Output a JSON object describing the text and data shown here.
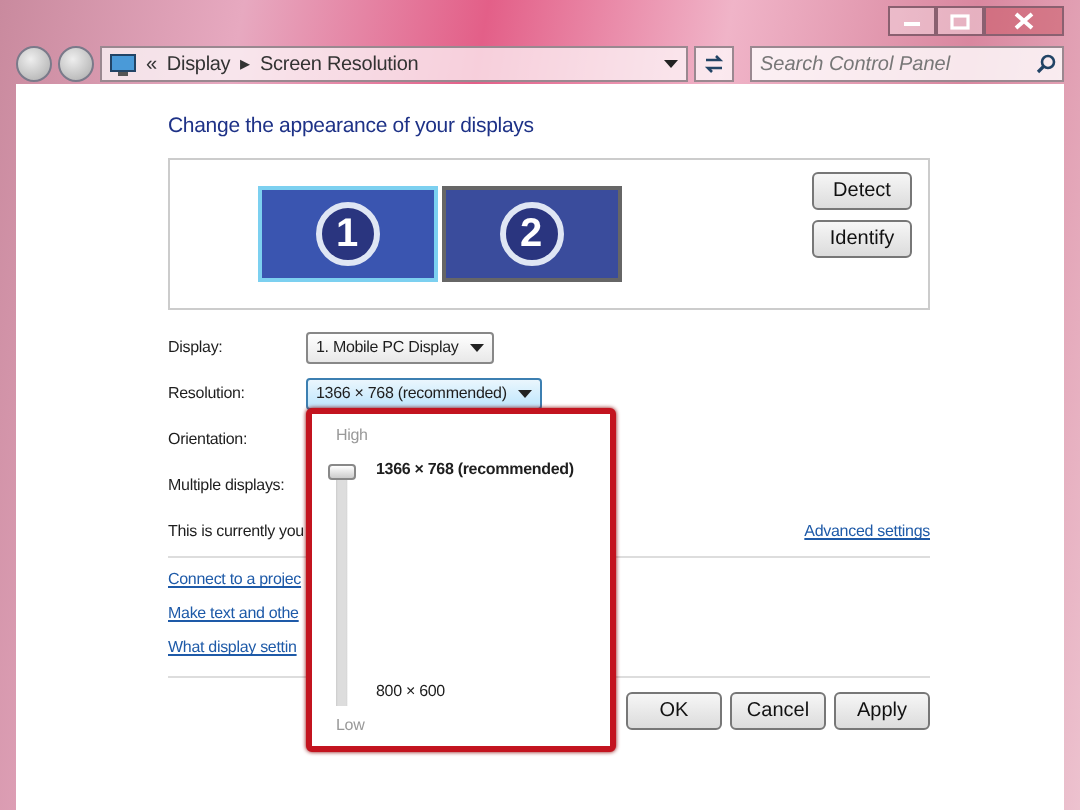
{
  "window": {
    "controls": [
      {
        "kind": "minimize"
      },
      {
        "kind": "maximize"
      },
      {
        "kind": "close"
      }
    ]
  },
  "nav": {
    "back_disabled": true,
    "forward_disabled": true
  },
  "address_bar": {
    "overflow": "«",
    "crumbs": [
      "Display",
      "Screen Resolution"
    ],
    "separator": "▸"
  },
  "search": {
    "placeholder": "Search Control Panel"
  },
  "heading": "Change the appearance of your displays",
  "monitors": [
    {
      "number": "1",
      "selected": true
    },
    {
      "number": "2",
      "selected": false
    }
  ],
  "monitor_buttons": [
    "Detect",
    "Identify"
  ],
  "settings": [
    {
      "label": "Display:",
      "value": "1. Mobile PC Display",
      "expanded": false
    },
    {
      "label": "Resolution:",
      "value": "1366 × 768 (recommended)",
      "expanded": true
    },
    {
      "label": "Orientation:"
    },
    {
      "label": "Multiple displays:"
    }
  ],
  "current_note": "This is currently you",
  "advanced_link": "Advanced settings",
  "links": [
    "Connect to a projec",
    "Make text and othe",
    "What display settin"
  ],
  "buttons": [
    "OK",
    "Cancel",
    "Apply"
  ],
  "resolution_popup": {
    "high": "High",
    "low": "Low",
    "top_option": "1366 × 768 (recommended)",
    "bottom_option": "800 × 600",
    "level": 1
  }
}
